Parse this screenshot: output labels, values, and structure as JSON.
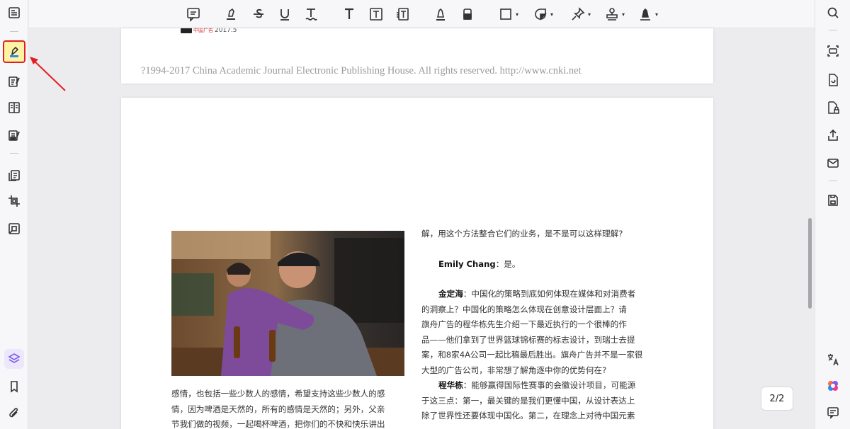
{
  "page1": {
    "masthead_red": "中国广告",
    "masthead_year": "2017.5",
    "copyright": "?1994-2017 China Academic Journal Electronic Publishing House. All rights reserved.    http://www.cnki.net"
  },
  "page2": {
    "left_lines": [
      "感情，也包括一些少数人的感情，希望支持这些少数人的感",
      "情，因为啤酒是天然的，所有的感情是天然的；另外，父亲",
      "节我们做的视频，一起喝杯啤酒，把你们的不快和快乐讲出"
    ],
    "right": {
      "l1": "解，用这个方法整合它们的业务，是不是可以这样理解?",
      "emily_name": "Emily Chang",
      "emily_text": "：是。",
      "jin_name": "金定海",
      "jin_l1": "：中国化的策略到底如何体现在媒体和对消费者",
      "jin_l2": "的洞察上？中国化的策略怎么体现在创意设计层面上？请",
      "jin_l3": "旗舟广告的程华栋先生介绍一下最近执行的一个很棒的作",
      "jin_l4": "品——他们拿到了世界篮球锦标赛的标志设计，到瑞士去提",
      "jin_l5": "案，和8家4A公司一起比稿最后胜出。旗舟广告并不是一家很",
      "jin_l6": "大型的广告公司，非常想了解角逐中你的优势何在?",
      "cheng_name": "程华栋",
      "cheng_l1": "：能够赢得国际性赛事的会徽设计项目，可能源",
      "cheng_l2": "于这三点：第一，最关键的是我们更懂中国，从设计表达上",
      "cheng_l3": "除了世界性还要体现中国化。第二，在理念上对待中国元素"
    }
  },
  "page_indicator": "2/2",
  "colors": {
    "highlight_active": "#fff3a3",
    "callout_red": "#e02020",
    "layers_accent": "#7b5cf0"
  }
}
